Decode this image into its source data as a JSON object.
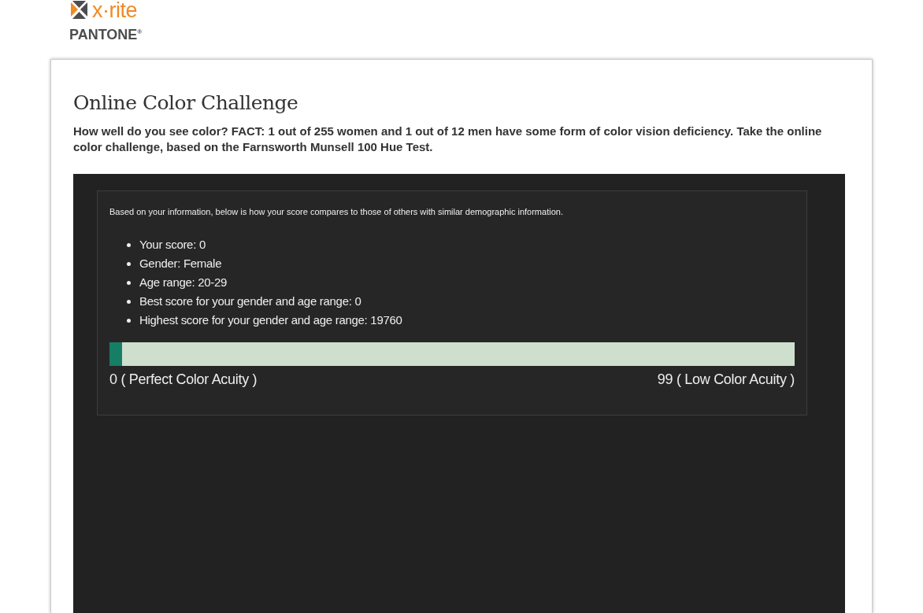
{
  "logo": {
    "brand": "x·rite",
    "sub": "PANTONE$^{®}$"
  },
  "title": "Online Color Challenge",
  "intro": "How well do you see color? FACT: 1 out of 255 women and 1 out of 12 men have some form of color vision deficiency. Take the online color challenge, based on the Farnsworth Munsell 100 Hue Test.",
  "results": {
    "note": "Based on your information, below is how your score compares to those of others with similar demographic information.",
    "items": [
      "Your score: 0",
      "Gender: Female",
      "Age range: 20-29",
      "Best score for your gender and age range: 0",
      "Highest score for your gender and age range: 19760"
    ],
    "score_bar": {
      "level": 0.018,
      "min_label": "0 ( Perfect Color Acuity )",
      "max_label": "99 ( Low Color Acuity )"
    }
  }
}
